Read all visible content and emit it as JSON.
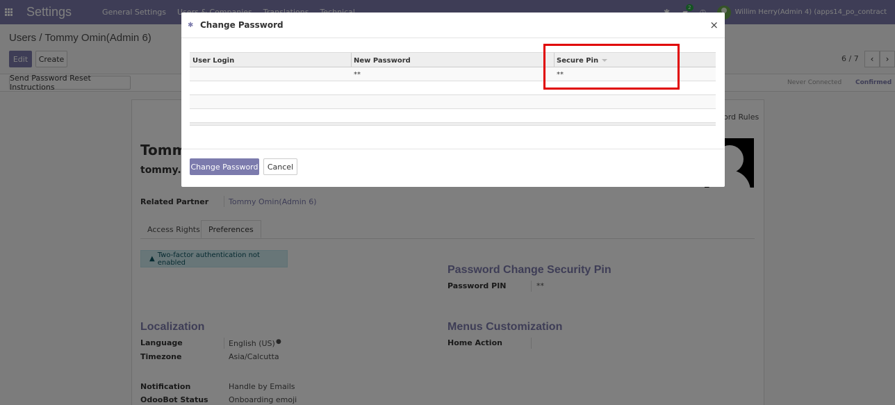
{
  "topnav": {
    "brand": "Settings",
    "menu": [
      "General Settings",
      "Users & Companies",
      "Translations",
      "Technical"
    ],
    "chat_badge": "2",
    "user": "Willim Herry(Admin 4) (apps14_po_contract"
  },
  "control": {
    "breadcrumb_root": "Users",
    "breadcrumb_sep": "/",
    "breadcrumb_current": "Tommy Omin(Admin 6)",
    "edit_label": "Edit",
    "create_label": "Create",
    "pager": "6 / 7",
    "reset_label": "Send Password Reset Instructions",
    "status_steps": [
      "Never Connected",
      "Confirmed"
    ]
  },
  "sheet": {
    "name_partial": "Tomm",
    "login_partial": "tommy.c",
    "record_rules_partial": "ord Rules",
    "related_partner_label": "Related Partner",
    "related_partner_value": "Tommy Omin(Admin 6)",
    "tabs": [
      "Access Rights",
      "Preferences"
    ],
    "twofa_alert": "Two-factor authentication not enabled",
    "security_pin_title": "Password Change Security Pin",
    "password_pin_label": "Password PIN",
    "password_pin_value": "**",
    "localization_title": "Localization",
    "language_label": "Language",
    "language_value": "English (US)",
    "timezone_label": "Timezone",
    "timezone_value": "Asia/Calcutta",
    "notification_label": "Notification",
    "notification_value": "Handle by Emails",
    "odoobot_label": "OdooBot Status",
    "odoobot_value": "Onboarding emoji",
    "menus_title": "Menus Customization",
    "home_action_label": "Home Action"
  },
  "modal": {
    "title": "Change Password",
    "close": "×",
    "columns": [
      "User Login",
      "New Password",
      "Secure Pin"
    ],
    "rows": [
      {
        "user_login": "",
        "new_password": "**",
        "secure_pin": "**"
      }
    ],
    "change_password_label": "Change Password",
    "cancel_label": "Cancel"
  },
  "colors": {
    "primary": "#7c7bad",
    "highlight": "#e00000"
  }
}
